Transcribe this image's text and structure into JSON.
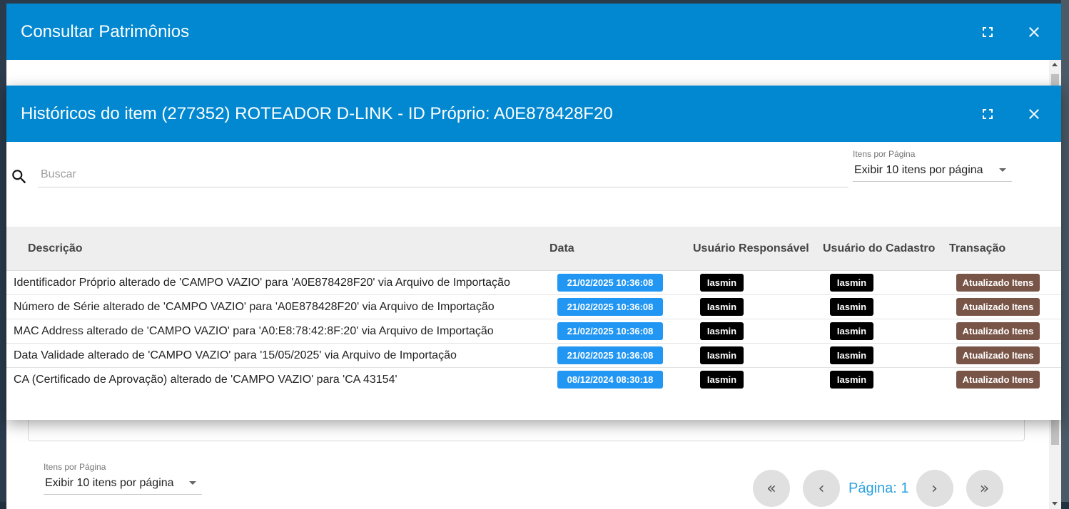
{
  "outer": {
    "title": "Consultar Patrimônios",
    "items_per_page": {
      "label": "Itens por Página",
      "value": "Exibir 10 itens por página"
    },
    "pager": {
      "first": "«",
      "prev": "‹",
      "page_label": "Página: 1",
      "next": "›",
      "last": "»"
    }
  },
  "inner": {
    "title": "Históricos do item (277352) ROTEADOR D-LINK - ID Próprio: A0E878428F20",
    "search": {
      "placeholder": "Buscar",
      "value": ""
    },
    "items_per_page": {
      "label": "Itens por Página",
      "value": "Exibir 10 itens por página"
    },
    "columns": [
      "Descrição",
      "Data",
      "Usuário Responsável",
      "Usuário do Cadastro",
      "Transação"
    ],
    "rows": [
      {
        "desc": "Identificador Próprio alterado de 'CAMPO VAZIO' para 'A0E878428F20' via Arquivo de Importação",
        "date": "21/02/2025 10:36:08",
        "resp": "Iasmin",
        "cad": "Iasmin",
        "trans": "Atualizado Itens"
      },
      {
        "desc": "Número de Série alterado de 'CAMPO VAZIO' para 'A0E878428F20' via Arquivo de Importação",
        "date": "21/02/2025 10:36:08",
        "resp": "Iasmin",
        "cad": "Iasmin",
        "trans": "Atualizado Itens"
      },
      {
        "desc": "MAC Address alterado de 'CAMPO VAZIO' para 'A0:E8:78:42:8F:20' via Arquivo de Importação",
        "date": "21/02/2025 10:36:08",
        "resp": "Iasmin",
        "cad": "Iasmin",
        "trans": "Atualizado Itens"
      },
      {
        "desc": "Data Validade alterado de 'CAMPO VAZIO' para '15/05/2025' via Arquivo de Importação",
        "date": "21/02/2025 10:36:08",
        "resp": "Iasmin",
        "cad": "Iasmin",
        "trans": "Atualizado Itens"
      },
      {
        "desc": "CA (Certificado de Aprovação) alterado de 'CAMPO VAZIO' para 'CA 43154'",
        "date": "08/12/2024 08:30:18",
        "resp": "Iasmin",
        "cad": "Iasmin",
        "trans": "Atualizado Itens"
      }
    ]
  },
  "colors": {
    "header": "#0288d1",
    "date_badge": "#2196f3",
    "user_badge": "#000000",
    "transaction_badge": "#795548",
    "page_label": "#29a0e0"
  },
  "icons": [
    "fullscreen-icon",
    "close-icon",
    "search-icon",
    "chevron-down-icon",
    "first-page-icon",
    "prev-page-icon",
    "next-page-icon",
    "last-page-icon"
  ]
}
